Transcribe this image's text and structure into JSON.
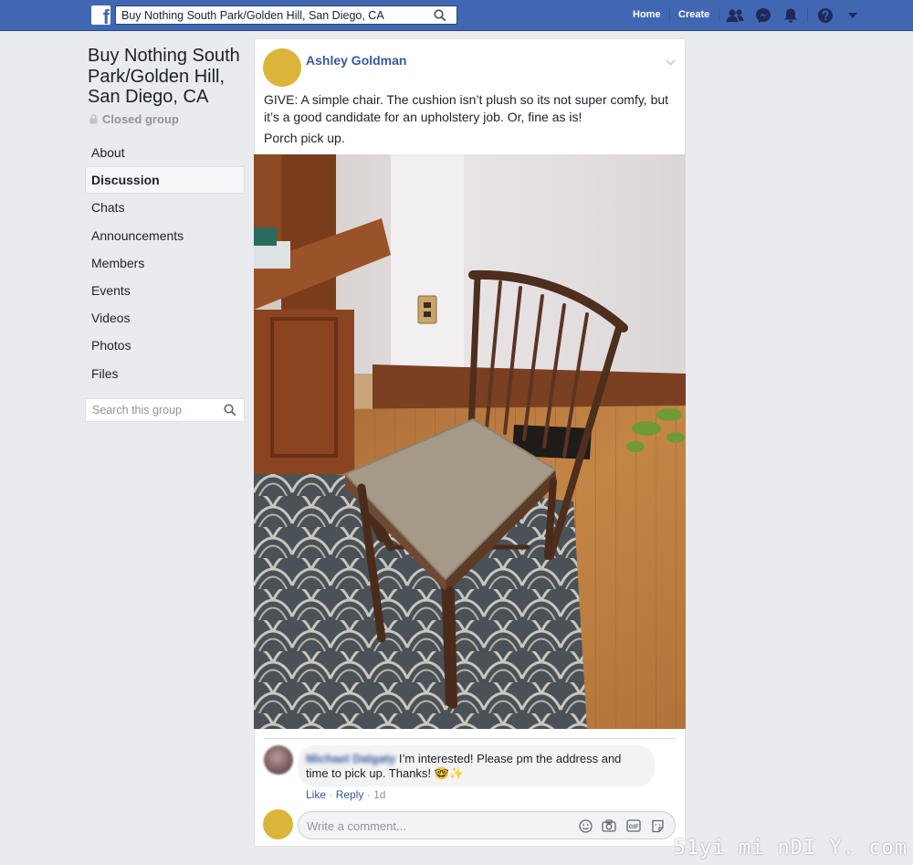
{
  "topbar": {
    "search_value": "Buy Nothing South Park/Golden Hill, San Diego, CA",
    "home_label": "Home",
    "create_label": "Create",
    "brand_color": "#4267b2"
  },
  "group": {
    "name": "Buy Nothing South Park/Golden Hill, San Diego, CA",
    "privacy": "Closed group",
    "nav": [
      {
        "label": "About"
      },
      {
        "label": "Discussion",
        "active": true
      },
      {
        "label": "Chats"
      },
      {
        "label": "Announcements"
      },
      {
        "label": "Members"
      },
      {
        "label": "Events"
      },
      {
        "label": "Videos"
      },
      {
        "label": "Photos"
      },
      {
        "label": "Files"
      }
    ],
    "search_placeholder": "Search this group"
  },
  "post": {
    "author": "Ashley Goldman",
    "text_1": "GIVE: A simple chair. The cushion isn’t plush so its not super comfy, but it’s a good candidate for an upholstery job. Or, fine as is!",
    "text_2": "Porch pick up.",
    "photo_subject": "wooden chair with beige cushion on patterned rug"
  },
  "comment": {
    "author": "Michael Dalgaty",
    "text": "I’m interested! Please pm the address and time to pick up. Thanks! 🤓✨",
    "like_label": "Like",
    "reply_label": "Reply",
    "age": "1d"
  },
  "composer": {
    "placeholder": "Write a comment..."
  },
  "watermark": "51yi mi nDI Y. com"
}
